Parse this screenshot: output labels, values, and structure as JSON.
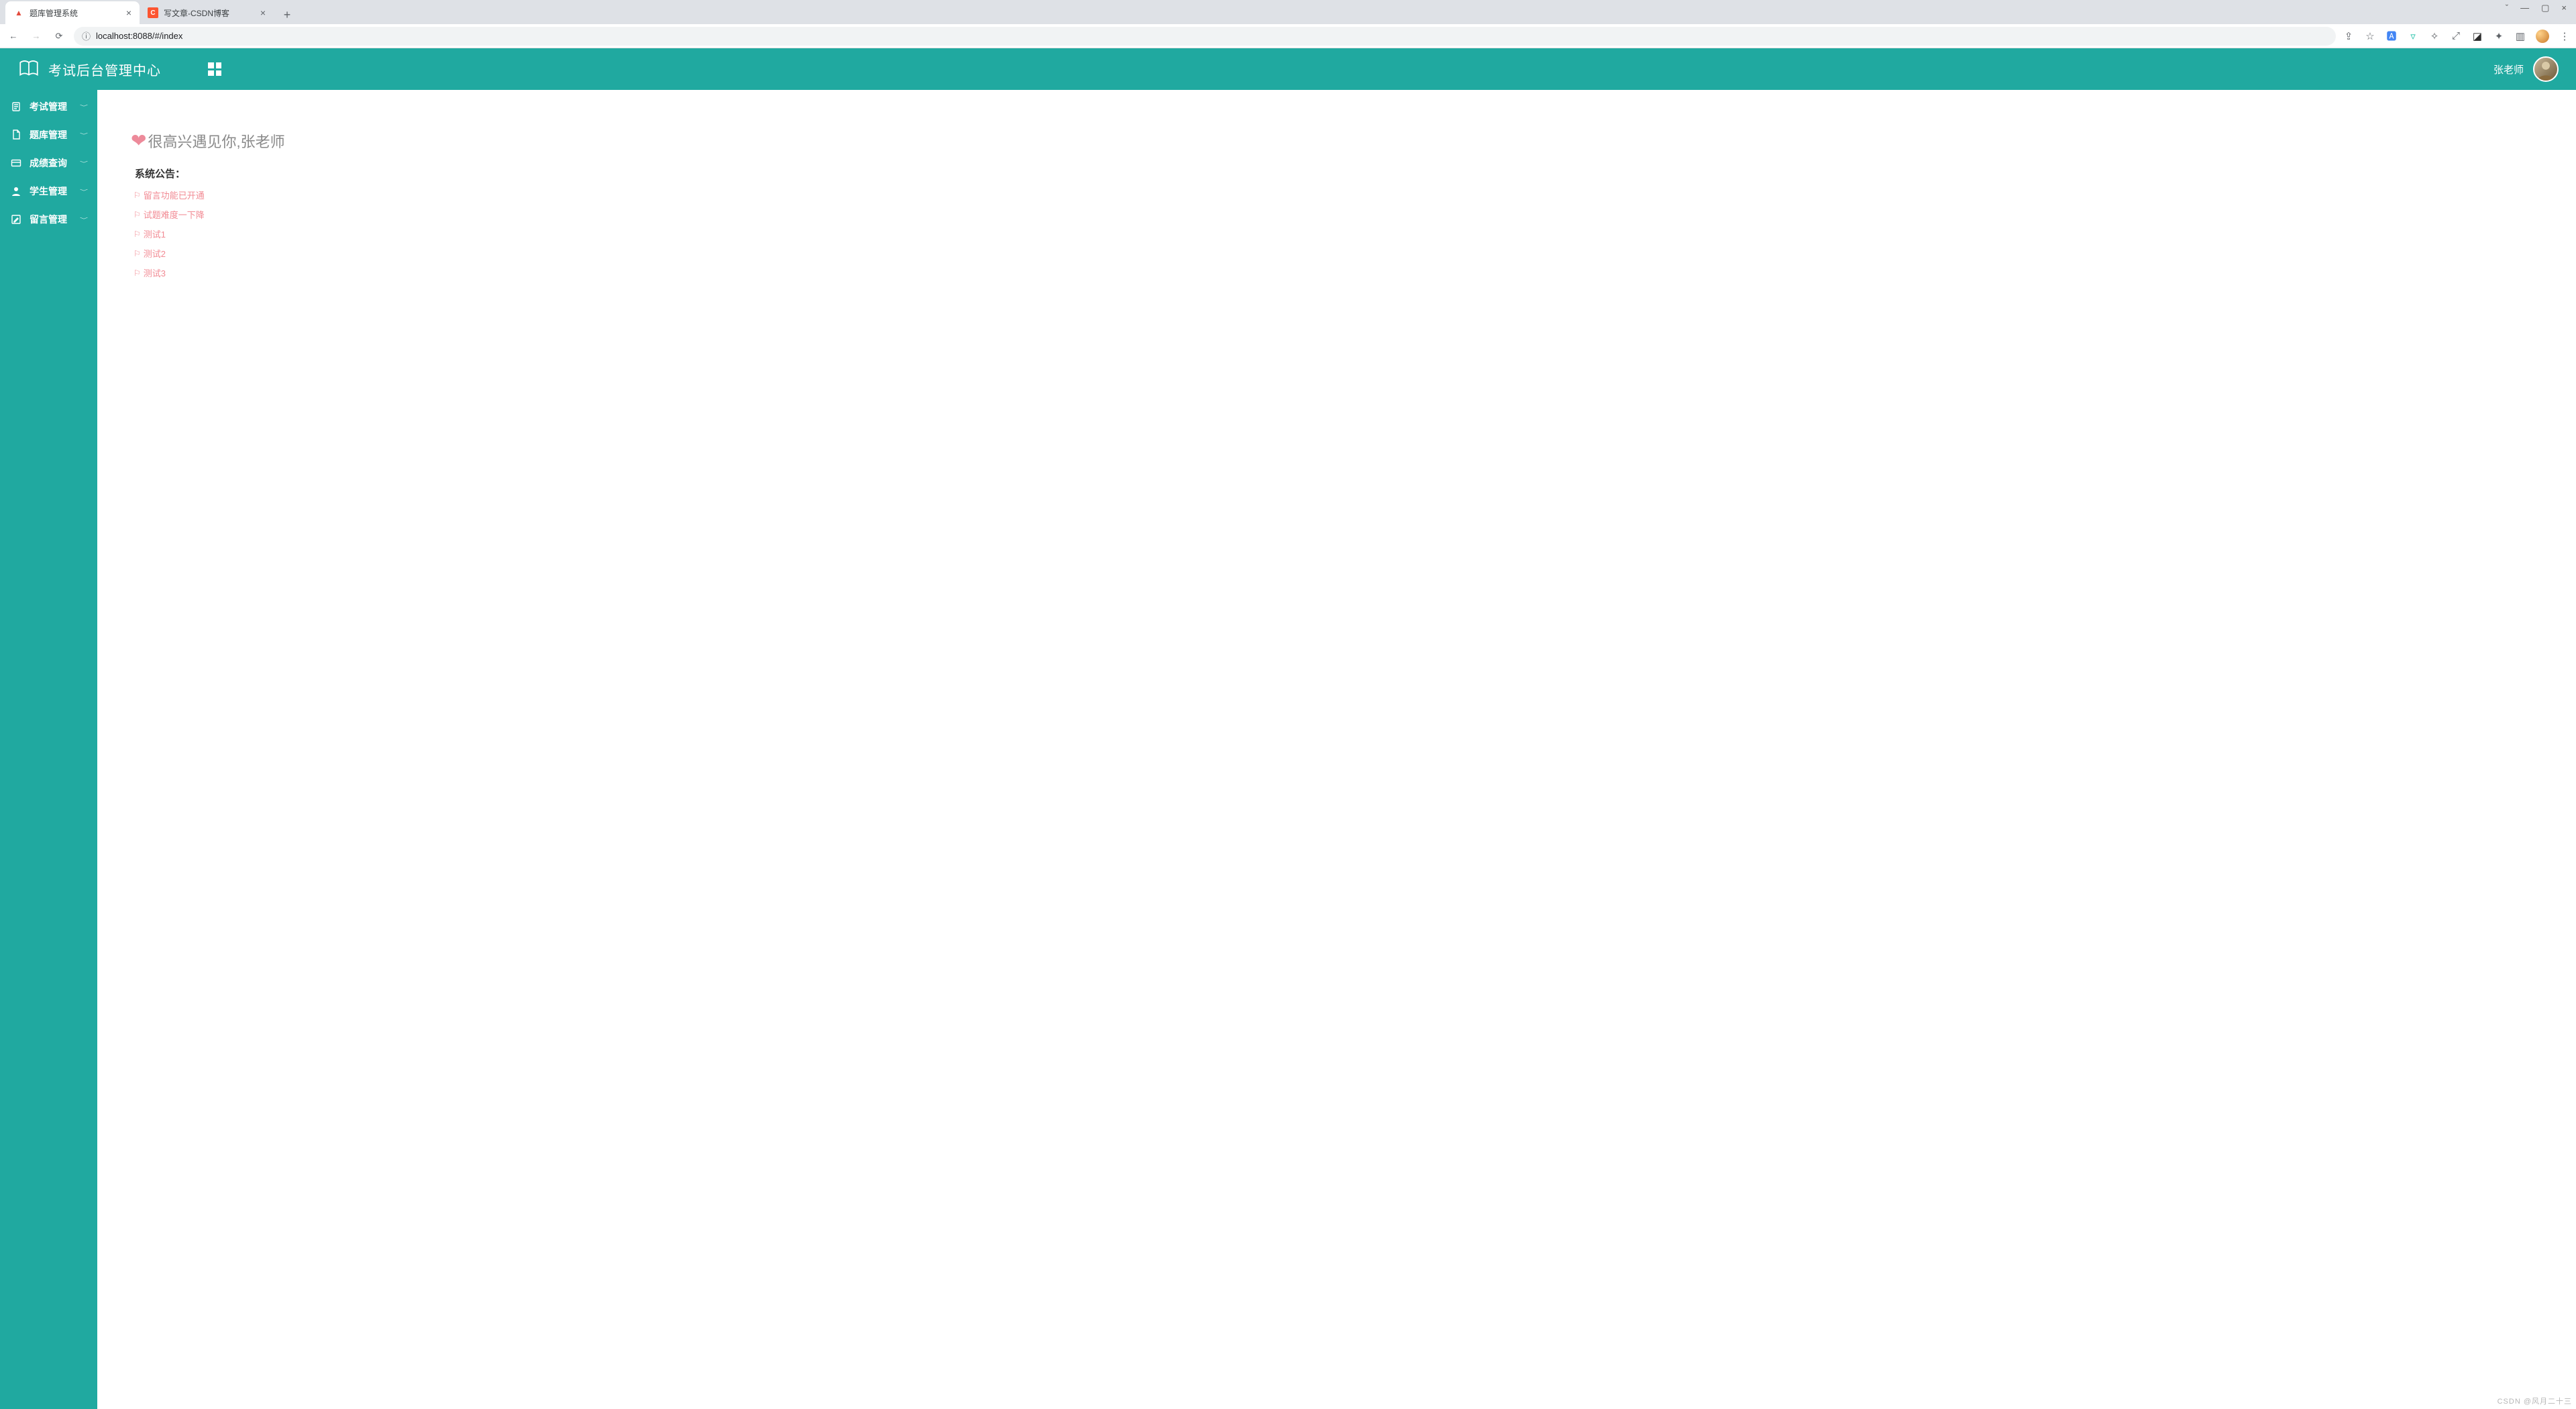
{
  "browser": {
    "tabs": [
      {
        "title": "题库管理系统",
        "favicon": "▲",
        "favicon_color": "#e34b3d",
        "active": true
      },
      {
        "title": "写文章-CSDN博客",
        "favicon": "C",
        "favicon_color": "#fc5531",
        "active": false
      }
    ],
    "url": "localhost:8088/#/index",
    "actions": {
      "share_icon": "share-icon",
      "star_icon": "star-icon",
      "translate_icon": "translate-icon",
      "vpn_icon": "vpn-icon",
      "sparkle_icon": "sparkle-icon",
      "resize_icon": "resize-icon",
      "shield_icon": "shield-icon",
      "puzzle_icon": "puzzle-icon",
      "panel_icon": "panel-icon",
      "menu_icon": "menu-icon"
    }
  },
  "header": {
    "title": "考试后台管理中心",
    "user_name": "张老师"
  },
  "sidebar": {
    "items": [
      {
        "label": "考试管理",
        "icon": "clipboard-icon"
      },
      {
        "label": "题库管理",
        "icon": "document-icon"
      },
      {
        "label": "成绩查询",
        "icon": "card-icon"
      },
      {
        "label": "学生管理",
        "icon": "user-icon"
      },
      {
        "label": "留言管理",
        "icon": "edit-icon"
      }
    ]
  },
  "main": {
    "welcome": "很高兴遇见你,张老师",
    "notice_title": "系统公告：",
    "notices": [
      "留言功能已开通",
      "试题难度一下降",
      "测试1",
      "测试2",
      "测试3"
    ]
  },
  "watermark": "CSDN @风月二十三"
}
